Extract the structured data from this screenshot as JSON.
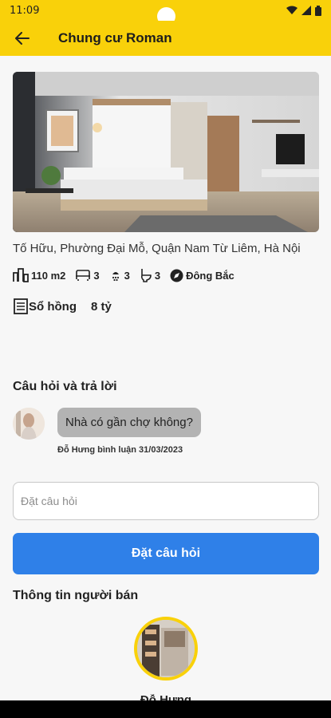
{
  "status_bar": {
    "time": "11:09"
  },
  "app_bar": {
    "title": "Chung cư Roman"
  },
  "listing": {
    "address": "Tố Hữu, Phường Đại Mỗ, Quận Nam Từ Liêm, Hà Nội",
    "specs": [
      {
        "icon": "building-icon",
        "value": "110 m2"
      },
      {
        "icon": "bed-icon",
        "value": "3"
      },
      {
        "icon": "shower-icon",
        "value": "3"
      },
      {
        "icon": "toilet-icon",
        "value": "3"
      },
      {
        "icon": "compass-icon",
        "value": "Đông Bắc"
      }
    ],
    "legal_status": "Sổ hồng",
    "price": "8 tỷ"
  },
  "qa": {
    "title": "Câu hỏi và trả lời",
    "items": [
      {
        "question": "Nhà có gần chợ không?",
        "meta": "Đỗ Hưng bình luận 31/03/2023"
      }
    ],
    "input_placeholder": "Đặt câu hỏi",
    "submit_label": "Đặt câu hỏi"
  },
  "seller": {
    "title": "Thông tin người bán",
    "name": "Đỗ Hưng"
  },
  "colors": {
    "accent": "#f9d10a",
    "button": "#2f80e8",
    "bubble": "#b3b3b3"
  }
}
